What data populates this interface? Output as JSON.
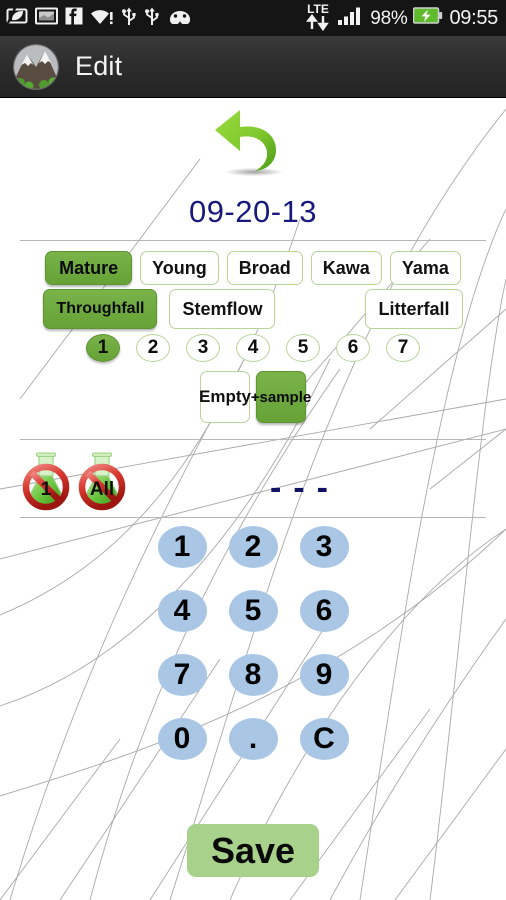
{
  "status_bar": {
    "icons": [
      "leaf-battery-icon",
      "image-icon",
      "facebook-icon",
      "wifi-alert-icon",
      "usb-icon",
      "usb-icon-2",
      "android-cyanogen-icon"
    ],
    "network_label": "LTE",
    "signal_icon": "signal-bars-icon",
    "battery_percent": "98%",
    "battery_icon": "battery-charging-icon",
    "clock": "09:55"
  },
  "action_bar": {
    "avatar": "mountain-avatar",
    "title": "Edit"
  },
  "main": {
    "undo_icon": "undo-arrow-icon",
    "date": "09-20-13",
    "stand_tags": [
      {
        "label": "Mature",
        "selected": true
      },
      {
        "label": "Young",
        "selected": false
      },
      {
        "label": "Broad",
        "selected": false
      },
      {
        "label": "Kawa",
        "selected": false
      },
      {
        "label": "Yama",
        "selected": false
      }
    ],
    "flux_tags": [
      {
        "label": "Throughfall",
        "selected": true,
        "small": true
      },
      {
        "label": "Stemflow",
        "selected": false,
        "small": false
      },
      {
        "label": "Litterfall",
        "selected": false,
        "small": false
      }
    ],
    "replicate_numbers": [
      {
        "label": "1",
        "selected": true
      },
      {
        "label": "2",
        "selected": false
      },
      {
        "label": "3",
        "selected": false
      },
      {
        "label": "4",
        "selected": false
      },
      {
        "label": "5",
        "selected": false
      },
      {
        "label": "6",
        "selected": false
      },
      {
        "label": "7",
        "selected": false
      }
    ],
    "sample_tags": [
      {
        "label": "Empty",
        "selected": false
      },
      {
        "label": "+sample",
        "selected": true
      }
    ],
    "flask_buttons": [
      {
        "label": "1",
        "icon": "no-flask-icon"
      },
      {
        "label": "All",
        "icon": "no-flask-all-icon"
      }
    ],
    "value_display": "- - -",
    "value_dashes": [
      "-",
      "-",
      "-"
    ],
    "keypad": [
      [
        "1",
        "2",
        "3"
      ],
      [
        "4",
        "5",
        "6"
      ],
      [
        "7",
        "8",
        "9"
      ],
      [
        "0",
        ".",
        "C"
      ]
    ],
    "save_label": "Save"
  },
  "colors": {
    "accent_green": "#6aa83c",
    "save_green": "#a8d18c",
    "keypad_blue": "#a9c6e4",
    "date_navy": "#1a1a7e",
    "tag_border": "#b9d49a"
  }
}
